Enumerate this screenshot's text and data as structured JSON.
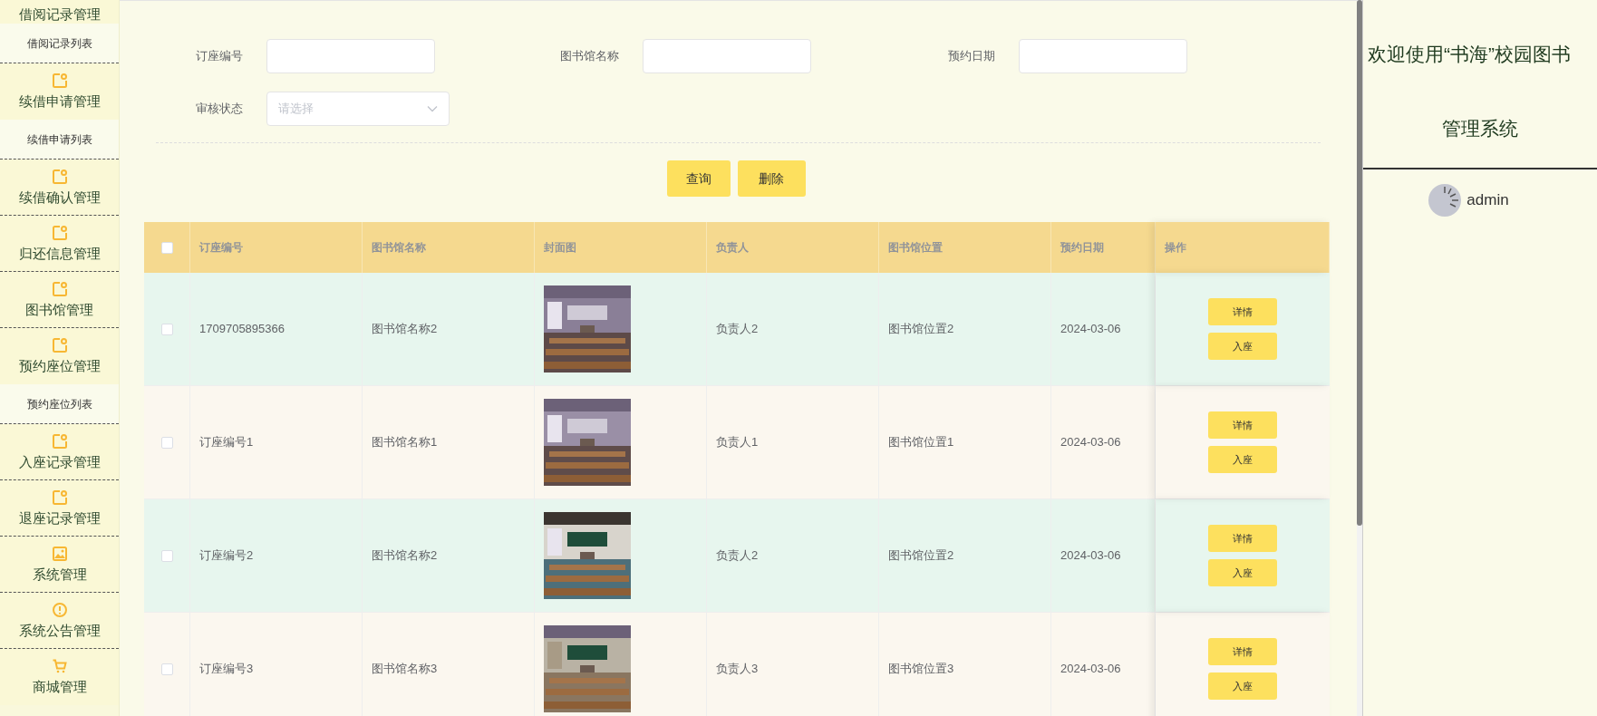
{
  "sidebar": {
    "items": [
      {
        "label": "借阅记录管理",
        "kind": "heading"
      },
      {
        "label": "借阅记录列表",
        "kind": "sub"
      },
      {
        "label": "续借申请管理",
        "kind": "heading"
      },
      {
        "label": "续借申请列表",
        "kind": "sub"
      },
      {
        "label": "续借确认管理",
        "kind": "heading"
      },
      {
        "label": "归还信息管理",
        "kind": "heading"
      },
      {
        "label": "图书馆管理",
        "kind": "heading"
      },
      {
        "label": "预约座位管理",
        "kind": "heading"
      },
      {
        "label": "预约座位列表",
        "kind": "sub"
      },
      {
        "label": "入座记录管理",
        "kind": "heading"
      },
      {
        "label": "退座记录管理",
        "kind": "heading"
      },
      {
        "label": "系统管理",
        "kind": "heading"
      },
      {
        "label": "系统公告管理",
        "kind": "heading"
      },
      {
        "label": "商城管理",
        "kind": "heading"
      }
    ]
  },
  "filters": [
    {
      "label": "订座编号",
      "kind": "text"
    },
    {
      "label": "图书馆名称",
      "kind": "text"
    },
    {
      "label": "预约日期",
      "kind": "text"
    },
    {
      "label": "审核状态",
      "kind": "select",
      "placeholder": "请选择"
    }
  ],
  "buttons": [
    "查询",
    "删除"
  ],
  "table": {
    "select_all": {
      "checked": false
    },
    "columns": [
      "订座编号",
      "图书馆名称",
      "封面图",
      "负责人",
      "图书馆位置",
      "预约日期",
      "操作"
    ],
    "rows": [
      {
        "checked": false,
        "number": "1709705895366",
        "library": "图书馆名称2",
        "manager": "负责人2",
        "location": "图书馆位置2",
        "date": "2024-03-06",
        "actions": [
          "详情",
          "入座"
        ]
      },
      {
        "checked": false,
        "number": "订座编号1",
        "library": "图书馆名称1",
        "manager": "负责人1",
        "location": "图书馆位置1",
        "date": "2024-03-06",
        "actions": [
          "详情",
          "入座"
        ]
      },
      {
        "checked": false,
        "number": "订座编号2",
        "library": "图书馆名称2",
        "manager": "负责人2",
        "location": "图书馆位置2",
        "date": "2024-03-06",
        "actions": [
          "详情",
          "入座"
        ]
      },
      {
        "checked": false,
        "number": "订座编号3",
        "library": "图书馆名称3",
        "manager": "负责人3",
        "location": "图书馆位置3",
        "date": "2024-03-06",
        "actions": [
          "详情",
          "入座"
        ]
      }
    ]
  },
  "header": {
    "title": "欢迎使用“书海”校园图书",
    "subtitle": "管理系统",
    "user": "admin"
  }
}
